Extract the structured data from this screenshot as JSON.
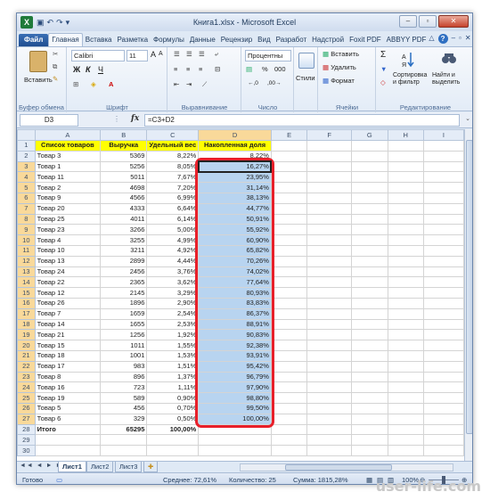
{
  "window": {
    "title": "Книга1.xlsx - Microsoft Excel",
    "qat": [
      "↶",
      "↷",
      "▾",
      "|",
      "▾"
    ],
    "buttons": [
      "–",
      "▫",
      "✕"
    ]
  },
  "tabs": [
    "Файл",
    "Главная",
    "Вставка",
    "Разметка",
    "Формулы",
    "Данные",
    "Рецензир",
    "Вид",
    "Разработ",
    "Надстрой",
    "Foxit PDF",
    "ABBYY PDF"
  ],
  "ribbon": {
    "clipboard": {
      "paste": "Вставить",
      "label": "Буфер обмена"
    },
    "font": {
      "name": "Calibri",
      "size": "11",
      "bold": "Ж",
      "italic": "К",
      "underline": "Ч",
      "grow": "A",
      "shrink": "A",
      "label": "Шрифт"
    },
    "alignment": {
      "label": "Выравнивание"
    },
    "number": {
      "format": "Процентны",
      "percent": "%",
      "thousands": "000",
      "label": "Число"
    },
    "styles": {
      "styles": "Стили"
    },
    "cells": {
      "insert": "Вставить",
      "delete": "Удалить",
      "format": "Формат",
      "label": "Ячейки"
    },
    "editing": {
      "sigma": "Σ",
      "sort": "Сортировка и фильтр",
      "find": "Найти и выделить",
      "label": "Редактирование"
    }
  },
  "formula_bar": {
    "name_box": "D3",
    "fx": "fx",
    "formula": "=C3+D2"
  },
  "columns": [
    "A",
    "B",
    "C",
    "D",
    "E",
    "F",
    "G",
    "H",
    "I"
  ],
  "rows": [
    [
      "1",
      "Список товаров",
      "Выручка",
      "Удельный вес",
      "Накопленная доля"
    ],
    [
      "2",
      "Товар 3",
      "5369",
      "8,22%",
      "8,22%"
    ],
    [
      "3",
      "Товар 1",
      "5256",
      "8,05%",
      "16,27%"
    ],
    [
      "4",
      "Товар 11",
      "5011",
      "7,67%",
      "23,95%"
    ],
    [
      "5",
      "Товар 2",
      "4698",
      "7,20%",
      "31,14%"
    ],
    [
      "6",
      "Товар 9",
      "4566",
      "6,99%",
      "38,13%"
    ],
    [
      "7",
      "Товар 20",
      "4333",
      "6,64%",
      "44,77%"
    ],
    [
      "8",
      "Товар 25",
      "4011",
      "6,14%",
      "50,91%"
    ],
    [
      "9",
      "Товар 23",
      "3266",
      "5,00%",
      "55,92%"
    ],
    [
      "10",
      "Товар 4",
      "3255",
      "4,99%",
      "60,90%"
    ],
    [
      "11",
      "Товар 10",
      "3211",
      "4,92%",
      "65,82%"
    ],
    [
      "12",
      "Товар 13",
      "2899",
      "4,44%",
      "70,26%"
    ],
    [
      "13",
      "Товар 24",
      "2456",
      "3,76%",
      "74,02%"
    ],
    [
      "14",
      "Товар 22",
      "2365",
      "3,62%",
      "77,64%"
    ],
    [
      "15",
      "Товар 12",
      "2145",
      "3,29%",
      "80,93%"
    ],
    [
      "16",
      "Товар 26",
      "1896",
      "2,90%",
      "83,83%"
    ],
    [
      "17",
      "Товар 7",
      "1659",
      "2,54%",
      "86,37%"
    ],
    [
      "18",
      "Товар 14",
      "1655",
      "2,53%",
      "88,91%"
    ],
    [
      "19",
      "Товар 21",
      "1256",
      "1,92%",
      "90,83%"
    ],
    [
      "20",
      "Товар 15",
      "1011",
      "1,55%",
      "92,38%"
    ],
    [
      "21",
      "Товар 18",
      "1001",
      "1,53%",
      "93,91%"
    ],
    [
      "22",
      "Товар 17",
      "983",
      "1,51%",
      "95,42%"
    ],
    [
      "23",
      "Товар 8",
      "896",
      "1,37%",
      "96,79%"
    ],
    [
      "24",
      "Товар 16",
      "723",
      "1,11%",
      "97,90%"
    ],
    [
      "25",
      "Товар 19",
      "589",
      "0,90%",
      "98,80%"
    ],
    [
      "26",
      "Товар 5",
      "456",
      "0,70%",
      "99,50%"
    ],
    [
      "27",
      "Товар 6",
      "329",
      "0,50%",
      "100,00%"
    ],
    [
      "28",
      "Итого",
      "65295",
      "100,00%",
      ""
    ],
    [
      "29",
      "",
      "",
      "",
      ""
    ],
    [
      "30",
      "",
      "",
      "",
      ""
    ]
  ],
  "sheets": [
    "Лист1",
    "Лист2",
    "Лист3"
  ],
  "status": {
    "ready": "Готово",
    "average": "Среднее: 72,61%",
    "count": "Количество: 25",
    "sum": "Сумма: 1815,28%",
    "zoom": "100%"
  },
  "watermark": "user-life.com",
  "colors": {
    "header_fill": "#ffff00",
    "selection_fill": "#b8d4f0",
    "highlight_border": "#e8202a"
  }
}
